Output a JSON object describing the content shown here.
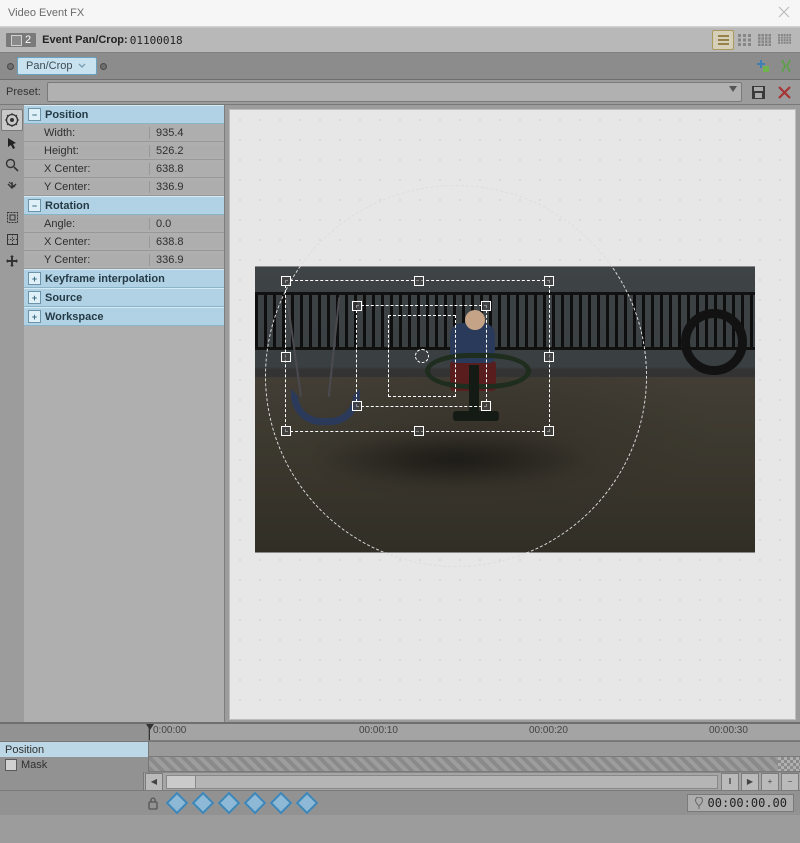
{
  "window": {
    "title": "Video Event FX"
  },
  "eventbar": {
    "tabNumber": "2",
    "label": "Event Pan/Crop:",
    "id": "01100018"
  },
  "chainTab": {
    "label": "Pan/Crop"
  },
  "presetLabel": "Preset:",
  "props": {
    "position": {
      "title": "Position",
      "width_l": "Width:",
      "width_v": "935.4",
      "height_l": "Height:",
      "height_v": "526.2",
      "xc_l": "X Center:",
      "xc_v": "638.8",
      "yc_l": "Y Center:",
      "yc_v": "336.9"
    },
    "rotation": {
      "title": "Rotation",
      "ang_l": "Angle:",
      "ang_v": "0.0",
      "xc_l": "X Center:",
      "xc_v": "638.8",
      "yc_l": "Y Center:",
      "yc_v": "336.9"
    },
    "kf": {
      "title": "Keyframe interpolation"
    },
    "src": {
      "title": "Source"
    },
    "ws": {
      "title": "Workspace"
    }
  },
  "timeline": {
    "ticks": [
      "0:00:00",
      "00:00:10",
      "00:00:20",
      "00:00:30"
    ],
    "tracks": {
      "position": "Position",
      "mask": "Mask"
    },
    "scrollEnd": "‖",
    "timecode": "00:00:00.00"
  },
  "glyphs": {
    "minus": "−",
    "plus": "+",
    "left": "◀",
    "right": "▶"
  }
}
